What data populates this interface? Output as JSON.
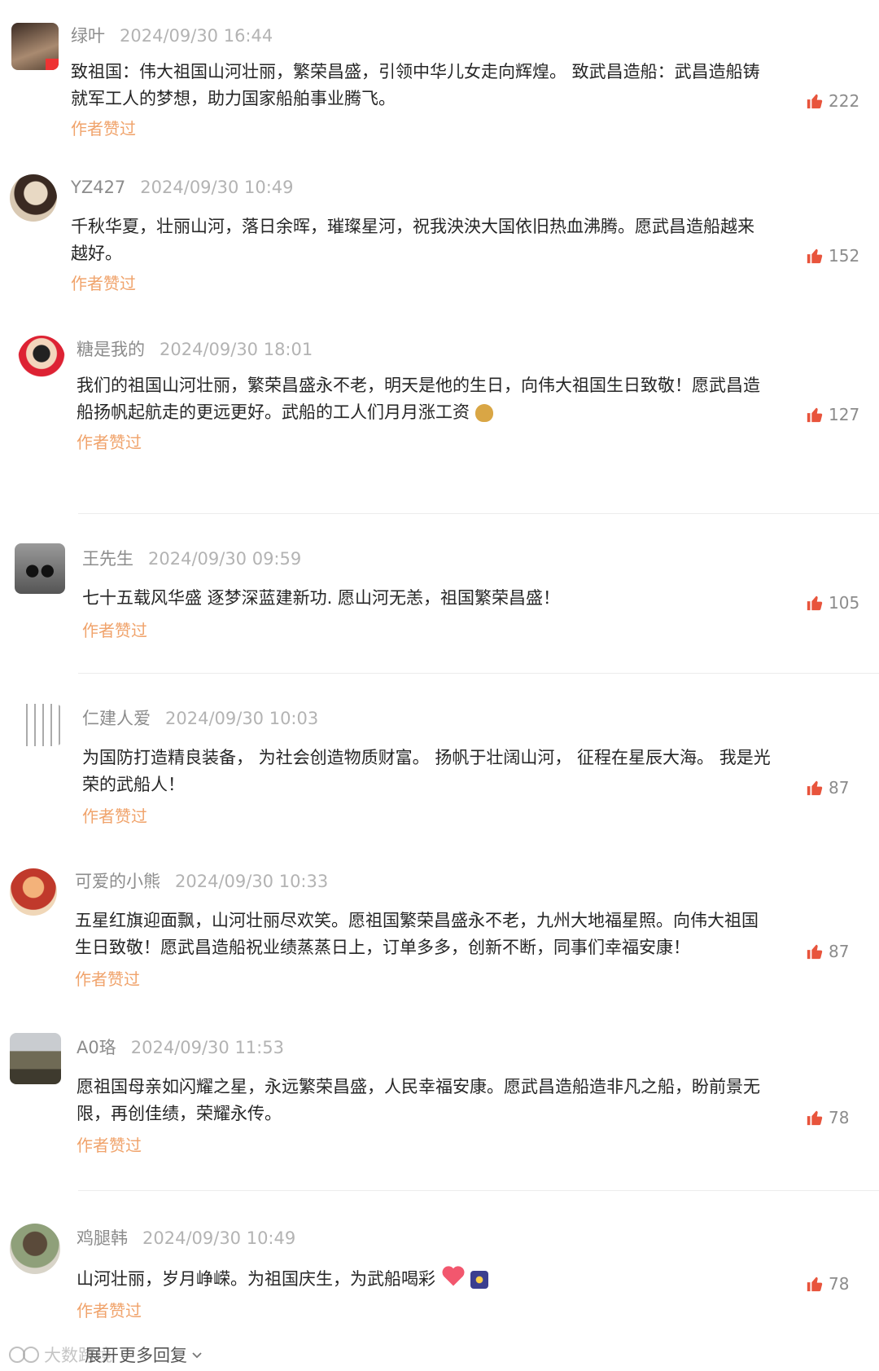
{
  "comments": [
    {
      "user": "绿叶",
      "time": "2024/09/30 16:44",
      "text": "致祖国：伟大祖国山河壮丽，繁荣昌盛，引领中华儿女走向辉煌。 致武昌造船：武昌造船铸就军工人的梦想，助力国家船舶事业腾飞。",
      "author_liked": "作者赞过",
      "likes": "222"
    },
    {
      "user": "YZ427",
      "time": "2024/09/30 10:49",
      "text": "千秋华夏，壮丽山河，落日余晖，璀璨星河，祝我泱泱大国依旧热血沸腾。愿武昌造船越来越好。",
      "author_liked": "作者赞过",
      "likes": "152"
    },
    {
      "user": "糖是我的",
      "time": "2024/09/30 18:01",
      "text": "我们的祖国山河壮丽，繁荣昌盛永不老，明天是他的生日，向伟大祖国生日致敬！愿武昌造船扬帆起航走的更远更好。武船的工人们月月涨工资",
      "author_liked": "作者赞过",
      "likes": "127"
    },
    {
      "user": "王先生",
      "time": "2024/09/30 09:59",
      "text": "七十五载风华盛 逐梦深蓝建新功. 愿山河无恙，祖国繁荣昌盛！",
      "author_liked": "作者赞过",
      "likes": "105"
    },
    {
      "user": "仁建人爱",
      "time": "2024/09/30 10:03",
      "text": "为国防打造精良装备， 为社会创造物质财富。 扬帆于壮阔山河， 征程在星辰大海。 我是光荣的武船人！",
      "author_liked": "作者赞过",
      "likes": "87"
    },
    {
      "user": "可爱的小熊",
      "time": "2024/09/30 10:33",
      "text": "五星红旗迎面飘，山河壮丽尽欢笑。愿祖国繁荣昌盛永不老，九州大地福星照。向伟大祖国生日致敬！愿武昌造船祝业绩蒸蒸日上，订单多多，创新不断，同事们幸福安康！",
      "author_liked": "作者赞过",
      "likes": "87"
    },
    {
      "user": "A0珞",
      "time": "2024/09/30 11:53",
      "text": "愿祖国母亲如闪耀之星，永远繁荣昌盛，人民幸福安康。愿武昌造船造非凡之船，盼前景无限，再创佳绩，荣耀永传。",
      "author_liked": "作者赞过",
      "likes": "78"
    },
    {
      "user": "鸡腿韩",
      "time": "2024/09/30 10:49",
      "text": "山河壮丽，岁月峥嵘。为祖国庆生，为武船喝彩",
      "author_liked": "作者赞过",
      "likes": "78"
    }
  ],
  "footer": {
    "more_label": "展开更多回复",
    "watermark": "大数跨境"
  },
  "colors": {
    "liked": "#f0a36b",
    "thumb": "#e8543c",
    "meta": "#8c8c8c"
  }
}
